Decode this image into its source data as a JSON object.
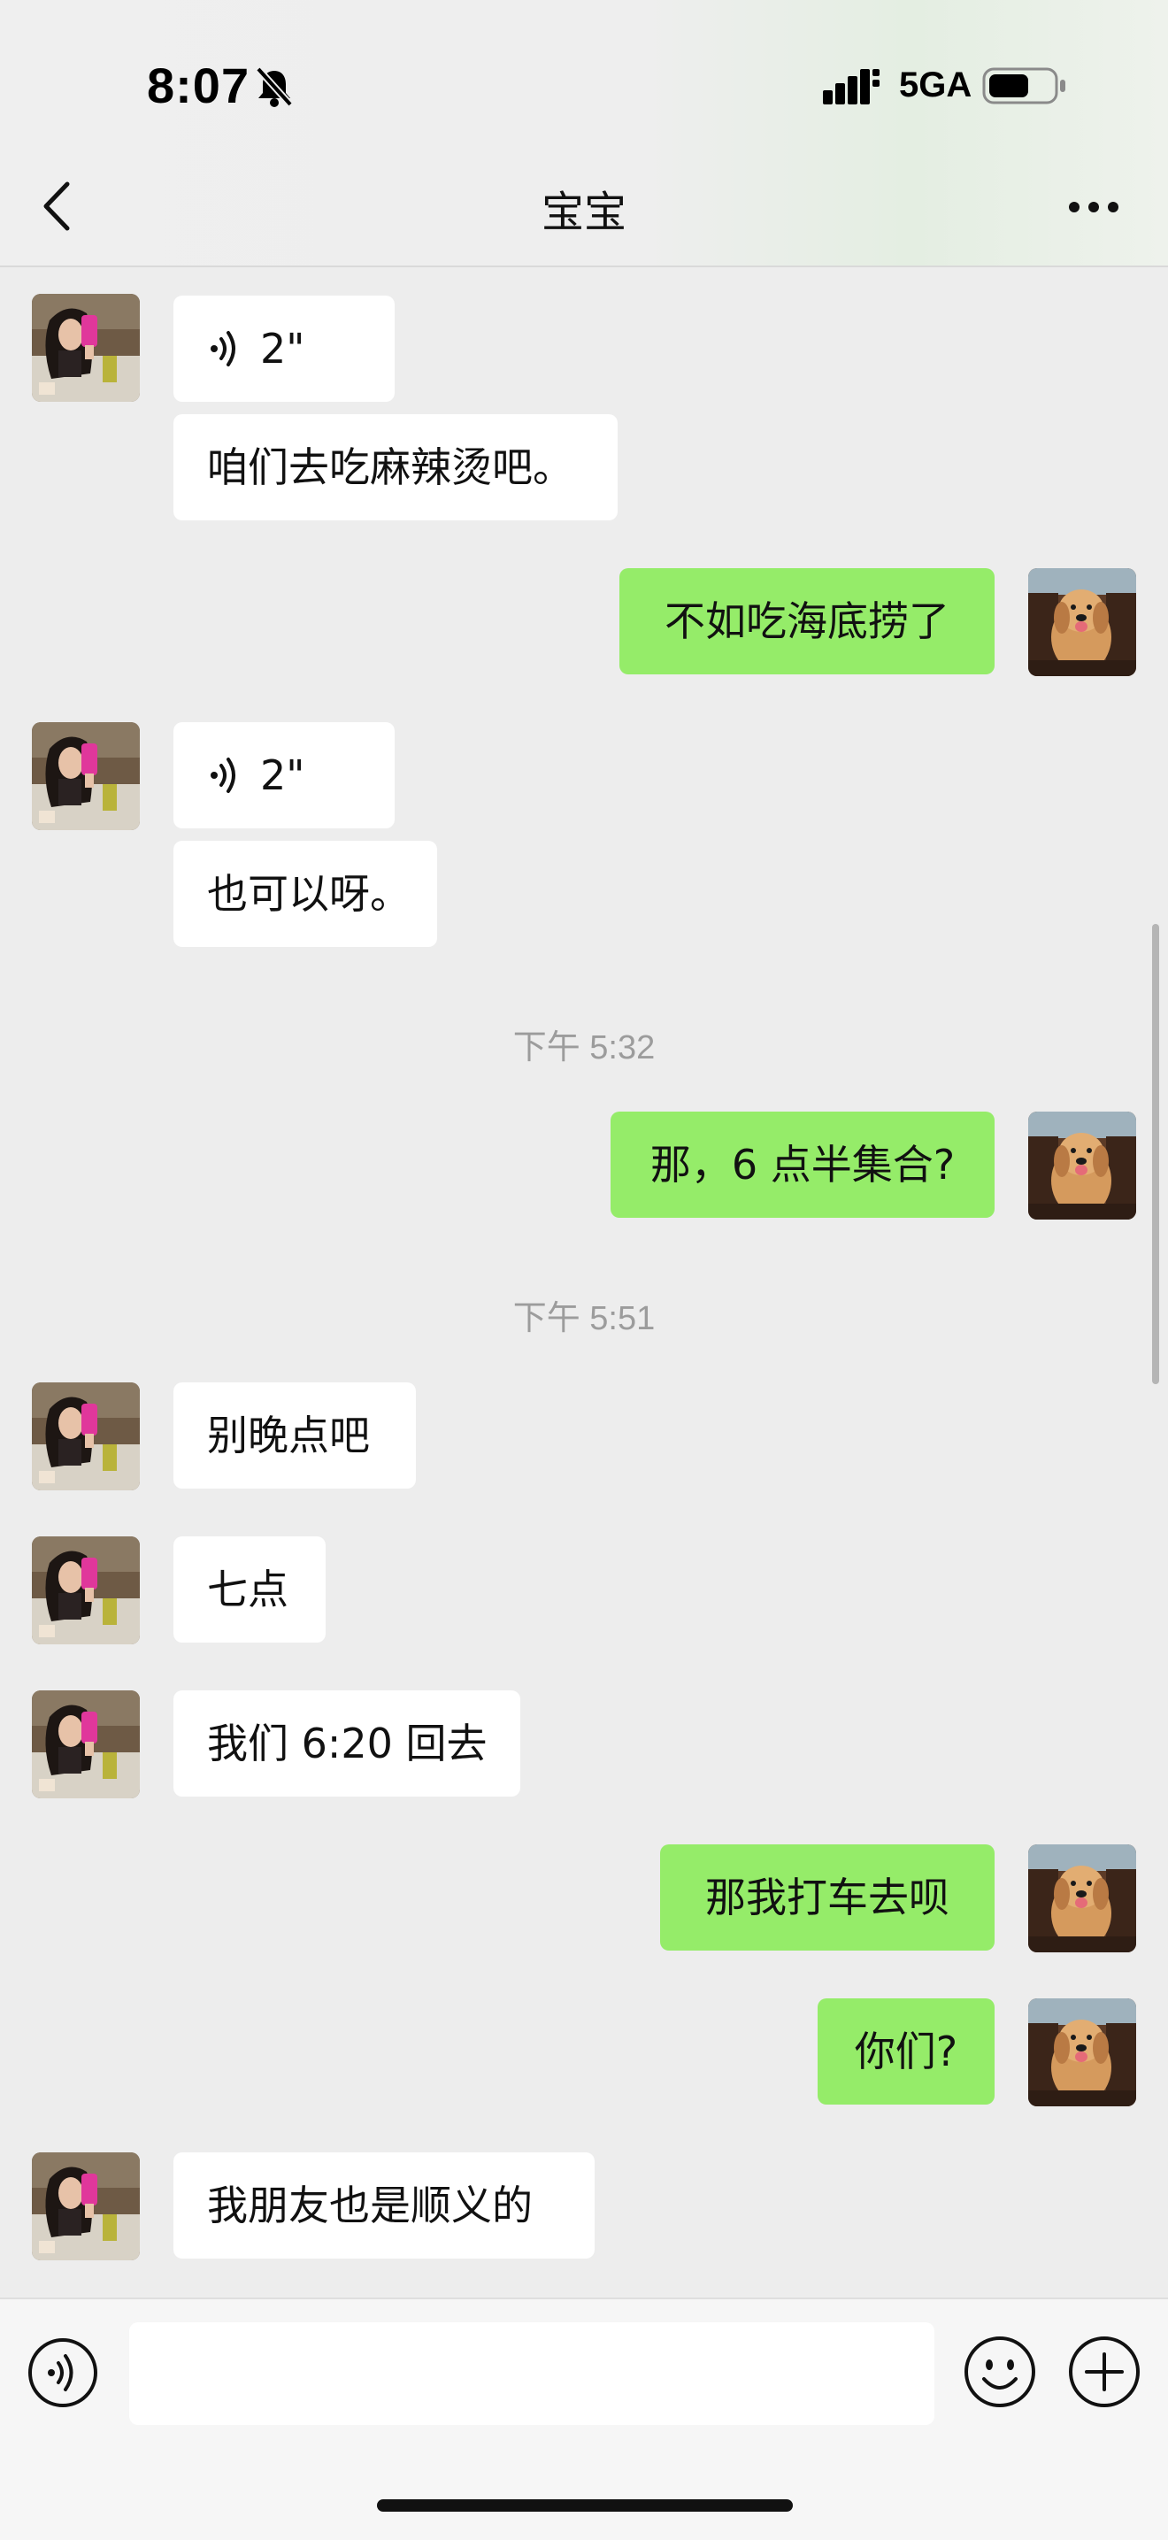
{
  "status_bar": {
    "time": "8:07",
    "network": "5GA",
    "mute_icon": "bell-slash-icon",
    "signal_icon": "signal-bars-icon",
    "battery_icon": "battery-icon"
  },
  "header": {
    "title": "宝宝",
    "back_icon": "chevron-left-icon",
    "more_icon": "ellipsis-icon"
  },
  "messages": {
    "m1_voice_duration": "2\"",
    "m2_text": "咱们去吃麻辣烫吧。",
    "m3_text": "不如吃海底捞了",
    "m4_voice_duration": "2\"",
    "m5_text": "也可以呀。",
    "t1_timestamp": "下午 5:32",
    "m6_text": "那，6 点半集合?",
    "t2_timestamp": "下午 5:51",
    "m7_text": "别晚点吧",
    "m8_text": "七点",
    "m9_text": "我们 6:20 回去",
    "m10_text": "那我打车去呗",
    "m11_text": "你们?",
    "m12_text": "我朋友也是顺义的"
  },
  "input_bar": {
    "value": "",
    "voice_icon": "voice-wave-icon",
    "emoji_icon": "smiley-icon",
    "plus_icon": "plus-circle-icon"
  },
  "colors": {
    "background": "#ededed",
    "outgoing_bubble": "#95ec69",
    "incoming_bubble": "#ffffff",
    "timestamp": "#9c9c9c"
  }
}
